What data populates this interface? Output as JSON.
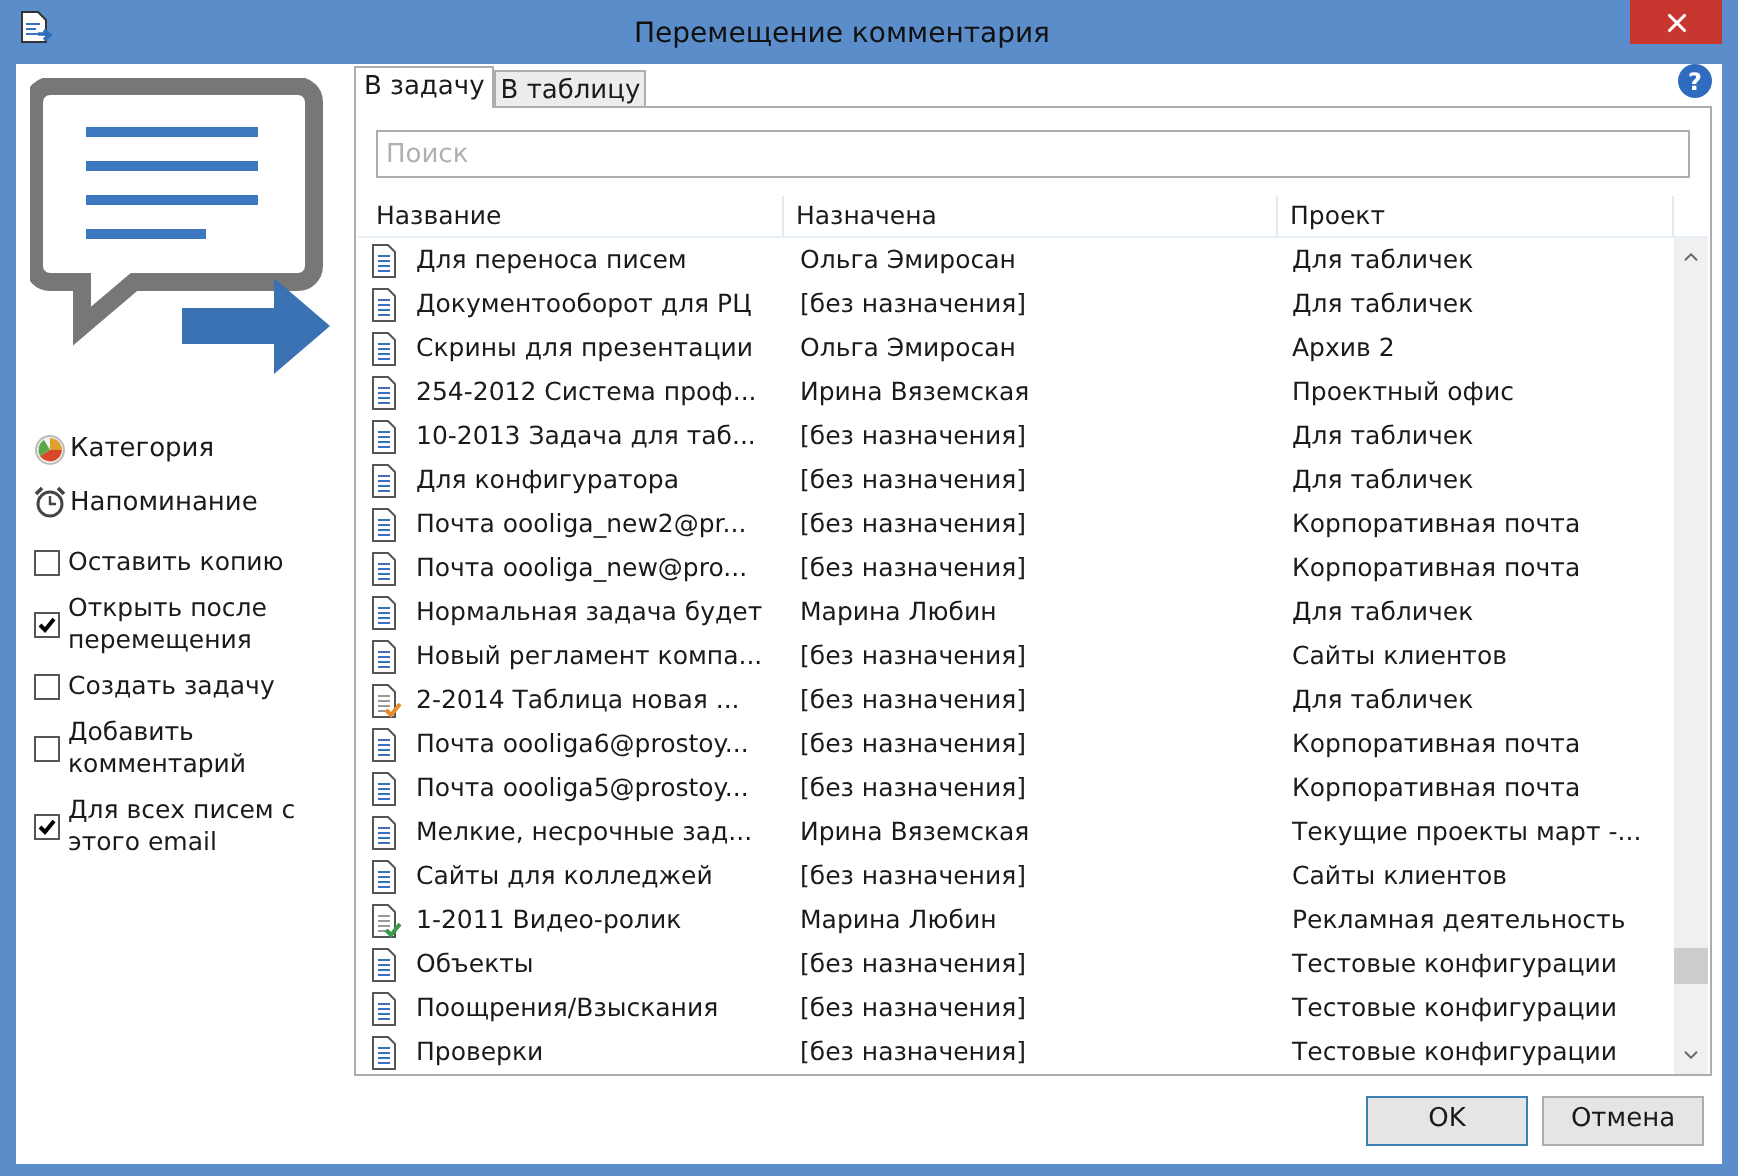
{
  "window": {
    "title": "Перемещение комментария"
  },
  "sidebar": {
    "links": [
      {
        "kind": "category",
        "label": "Категория"
      },
      {
        "kind": "reminder",
        "label": "Напоминание"
      }
    ],
    "options": [
      {
        "label": "Оставить копию",
        "checked": false
      },
      {
        "label": "Открыть после перемещения",
        "checked": true
      },
      {
        "label": "Создать задачу",
        "checked": false
      },
      {
        "label": "Добавить комментарий",
        "checked": false
      },
      {
        "label": "Для всех писем с этого email",
        "checked": true
      }
    ]
  },
  "tabs": [
    {
      "label": "В задачу",
      "selected": true
    },
    {
      "label": "В таблицу",
      "selected": false
    }
  ],
  "help": "?",
  "search": {
    "placeholder": "Поиск"
  },
  "table": {
    "columns": [
      "Название",
      "Назначена",
      "Проект"
    ],
    "rows": [
      {
        "kind": "doc",
        "name": "Для переноса писем",
        "assignee": "Ольга Эмиросан",
        "project": "Для табличек"
      },
      {
        "kind": "doc",
        "name": "Документооборот для РЦ",
        "assignee": "[без назначения]",
        "project": "Для табличек"
      },
      {
        "kind": "doc",
        "name": "Скрины для презентации",
        "assignee": "Ольга Эмиросан",
        "project": "Архив 2"
      },
      {
        "kind": "doc",
        "name": "254-2012 Система проф...",
        "assignee": "Ирина Вяземская",
        "project": "Проектный офис"
      },
      {
        "kind": "doc",
        "name": "10-2013 Задача для таб...",
        "assignee": "[без назначения]",
        "project": "Для табличек"
      },
      {
        "kind": "doc",
        "name": "Для конфигуратора",
        "assignee": "[без назначения]",
        "project": "Для табличек"
      },
      {
        "kind": "doc",
        "name": "Почта oooliga_new2@pr...",
        "assignee": "[без назначения]",
        "project": "Корпоративная почта"
      },
      {
        "kind": "doc",
        "name": "Почта oooliga_new@pro...",
        "assignee": "[без назначения]",
        "project": "Корпоративная почта"
      },
      {
        "kind": "doc",
        "name": "Нормальная задача будет",
        "assignee": "Марина Любин",
        "project": "Для табличек"
      },
      {
        "kind": "doc",
        "name": "Новый регламент компа...",
        "assignee": "[без назначения]",
        "project": "Сайты клиентов"
      },
      {
        "kind": "pending",
        "name": "2-2014 Таблица новая ...",
        "assignee": "[без назначения]",
        "project": "Для табличек"
      },
      {
        "kind": "doc",
        "name": "Почта oooliga6@prostoy...",
        "assignee": "[без назначения]",
        "project": "Корпоративная почта"
      },
      {
        "kind": "doc",
        "name": "Почта oooliga5@prostoy...",
        "assignee": "[без назначения]",
        "project": "Корпоративная почта"
      },
      {
        "kind": "doc",
        "name": "Мелкие, несрочные зад...",
        "assignee": "Ирина Вяземская",
        "project": "Текущие проекты март -..."
      },
      {
        "kind": "doc",
        "name": "Сайты для колледжей",
        "assignee": "[без назначения]",
        "project": "Сайты клиентов"
      },
      {
        "kind": "done",
        "name": "1-2011 Видео-ролик",
        "assignee": "Марина Любин",
        "project": "Рекламная деятельность"
      },
      {
        "kind": "doc",
        "name": "Объекты",
        "assignee": "[без назначения]",
        "project": "Тестовые конфигурации"
      },
      {
        "kind": "doc",
        "name": "Поощрения/Взыскания",
        "assignee": "[без назначения]",
        "project": "Тестовые конфигурации"
      },
      {
        "kind": "doc",
        "name": "Проверки",
        "assignee": "[без назначения]",
        "project": "Тестовые конфигурации"
      }
    ]
  },
  "buttons": [
    "OK",
    "Отмена"
  ]
}
